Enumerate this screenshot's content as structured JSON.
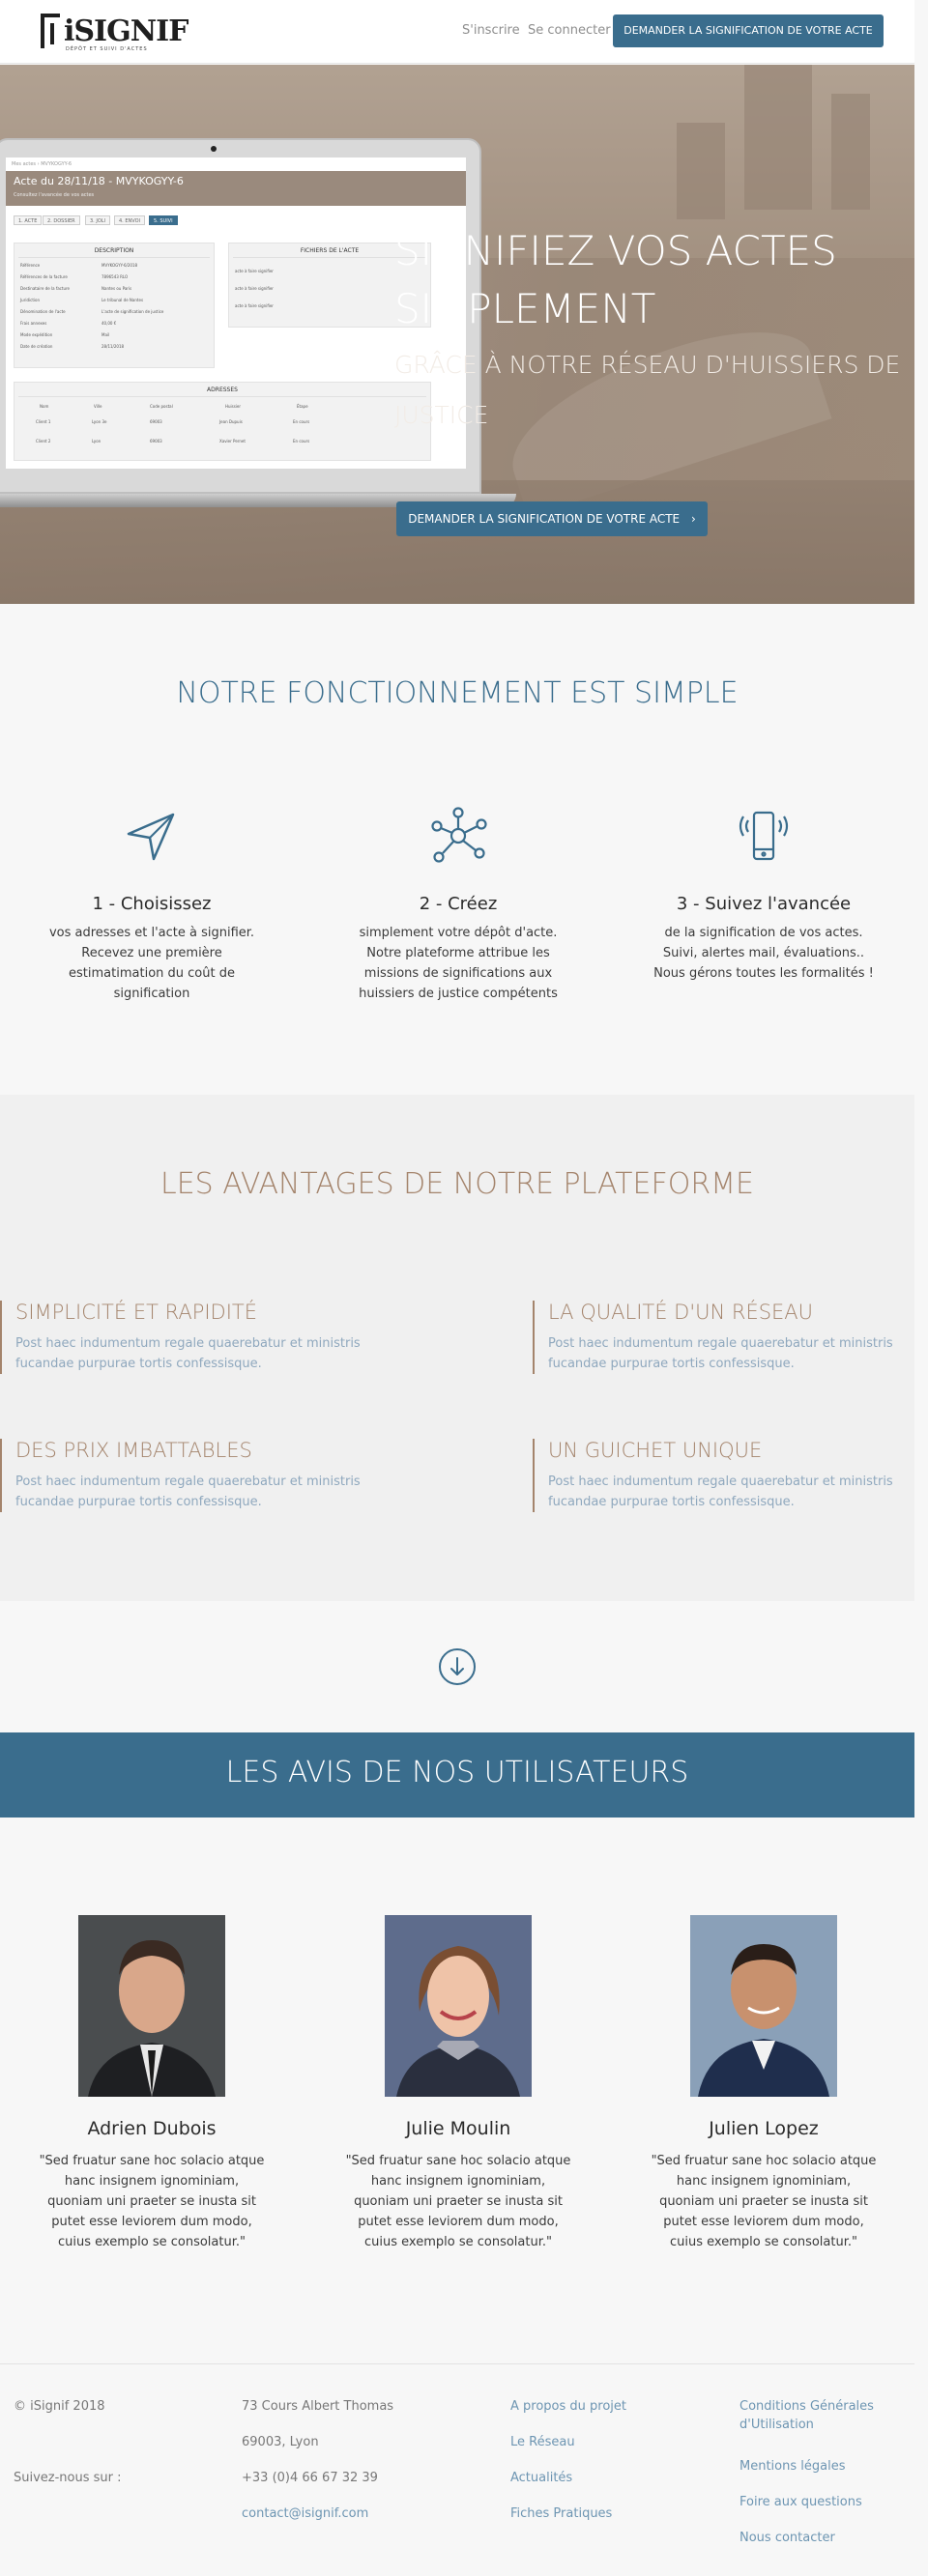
{
  "nav": {
    "logo_text": "iSIGNIF",
    "logo_tagline": "DÉPÔT ET SUIVI D'ACTES",
    "signup": "S'inscrire",
    "login": "Se connecter",
    "cta": "DEMANDER LA SIGNIFICATION DE VOTRE ACTE"
  },
  "hero": {
    "line1": "SIGNIFIEZ VOS ACTES",
    "line2": "SIMPLEMENT",
    "line3": "GRÂCE À NOTRE RÉSEAU D'HUISSIERS DE",
    "line4": "JUSTICE",
    "cta": "DEMANDER LA SIGNIFICATION DE VOTRE ACTE",
    "cta_arrow": "›",
    "screen": {
      "breadcrumb": "Mes actes  ›  MVYKOGYY-6",
      "title": "Acte du 28/11/18 - MVYKOGYY-6",
      "subtitle": "Consultez l'avancée de vos actes",
      "steps": [
        "1. ACTE",
        "2. DOSSIER",
        "3. JOLI",
        "4. ENVOI",
        "5. SUIVI"
      ],
      "desc_title": "DESCRIPTION",
      "desc_rows": [
        "Référence",
        "Références de la facture",
        "Destinataire de la facture",
        "Juridiction",
        "Dénomination de l'acte",
        "Frais annexes",
        "Mode expédition",
        "Date de création"
      ],
      "desc_values": [
        "MVYKOGYY-6/2018",
        "7896543 RLO",
        "Nantes ou Paris",
        "Le tribunal de Nantes",
        "L'acte de signification de justice",
        "40,00 €",
        "Mail",
        "28/11/2018"
      ],
      "files_title": "FICHIERS DE L'ACTE",
      "file_rows": [
        "acte à faire signifier",
        "acte à faire signifier",
        "acte à faire signifier"
      ],
      "addr_title": "ADRESSES",
      "addr_cols": [
        "Nom",
        "Ville",
        "Code postal",
        "Huissier",
        "Étape"
      ],
      "addr_rows": [
        [
          "Client 1",
          "Lyon 3e",
          "69003",
          "Jean Dupuis",
          "En cours"
        ],
        [
          "Client 2",
          "Lyon",
          "69003",
          "Xavier Pernet",
          "En cours"
        ]
      ]
    }
  },
  "how": {
    "title": "NOTRE FONCTIONNEMENT EST SIMPLE",
    "steps": [
      {
        "title": "1 - Choisissez",
        "desc": "vos adresses et l'acte à signifier. Recevez une première estimatimation du coût de signification",
        "icon": "paper-plane-icon"
      },
      {
        "title": "2 - Créez",
        "desc": "simplement votre dépôt d'acte. Notre plateforme attribue les missions de significations aux huissiers de justice compétents",
        "icon": "network-icon"
      },
      {
        "title": "3 - Suivez l'avancée",
        "desc": "de la signification de vos actes. Suivi, alertes mail, évaluations.. Nous gérons toutes les formalités !",
        "icon": "smartphone-icon"
      }
    ]
  },
  "advantages": {
    "title": "LES AVANTAGES DE NOTRE PLATEFORME",
    "items": [
      {
        "title": "SIMPLICITÉ ET RAPIDITÉ",
        "text": "Post haec indumentum regale quaerebatur et ministris fucandae purpurae tortis confessisque."
      },
      {
        "title": "LA QUALITÉ D'UN RÉSEAU",
        "text": "Post haec indumentum regale quaerebatur et ministris fucandae purpurae tortis confessisque."
      },
      {
        "title": "DES PRIX IMBATTABLES",
        "text": "Post haec indumentum regale quaerebatur et ministris fucandae purpurae tortis confessisque."
      },
      {
        "title": "UN GUICHET UNIQUE",
        "text": "Post haec indumentum regale quaerebatur et ministris fucandae purpurae tortis confessisque."
      }
    ]
  },
  "reviews": {
    "title": "LES AVIS DE NOS UTILISATEURS",
    "users": [
      {
        "name": "Adrien Dubois",
        "quote": "\"Sed fruatur sane hoc solacio atque hanc insignem ignominiam, quoniam uni praeter se inusta sit putet esse leviorem dum modo, cuius exemplo se consolatur.\""
      },
      {
        "name": "Julie Moulin",
        "quote": "\"Sed fruatur sane hoc solacio atque hanc insignem ignominiam, quoniam uni praeter se inusta sit putet esse leviorem dum modo, cuius exemplo se consolatur.\""
      },
      {
        "name": "Julien Lopez",
        "quote": "\"Sed fruatur sane hoc solacio atque hanc insignem ignominiam, quoniam uni praeter se inusta sit putet esse leviorem dum modo, cuius exemplo se consolatur.\""
      }
    ]
  },
  "footer": {
    "copyright": "© iSignif 2018",
    "follow": "Suivez-nous sur :",
    "address1": "73 Cours Albert Thomas",
    "address2": "69003, Lyon",
    "phone": "+33 (0)4 66 67 32 39",
    "email": "contact@isignif.com",
    "links1": [
      "A propos du projet",
      "Le Réseau",
      "Actualités",
      "Fiches Pratiques"
    ],
    "links2_a": "Conditions Générales",
    "links2_b": "d'Utilisation",
    "links2": [
      "Mentions légales",
      "Foire aux questions",
      "Nous contacter"
    ]
  },
  "colors": {
    "accent": "#3a6d8d",
    "bronze": "#a4846c",
    "muted_blue": "#8fa8be"
  }
}
